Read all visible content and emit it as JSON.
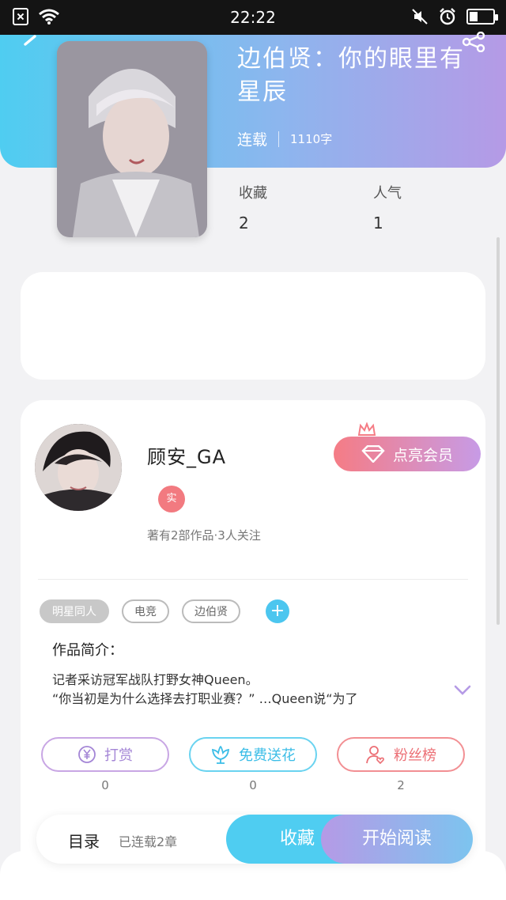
{
  "status_bar": {
    "time": "22:22",
    "icons": [
      "no-sim-icon",
      "wifi-icon",
      "mute-icon",
      "alarm-icon",
      "battery-icon"
    ],
    "battery_level": 0.35
  },
  "book": {
    "title": "边伯贤：你的眼里有星辰",
    "status": "连载",
    "word_count": "1110字",
    "favorites_label": "收藏",
    "favorites_value": "2",
    "popularity_label": "人气",
    "popularity_value": "1"
  },
  "author": {
    "name": "顾安_GA",
    "badge": "实",
    "stats": "著有2部作品·3人关注",
    "vip_button": "点亮会员"
  },
  "tags": [
    {
      "label": "明星同人",
      "filled": true
    },
    {
      "label": "电竞",
      "filled": false
    },
    {
      "label": "边伯贤",
      "filled": false
    }
  ],
  "tag_add": "+",
  "intro": {
    "heading": "作品简介：",
    "line1": "记者采访冠军战队打野女神Queen。",
    "line2": "“你当初是为什么选择去打职业赛？” …Queen说“为了"
  },
  "actions": [
    {
      "label": "打赏",
      "count": "0",
      "icon": "yuan-icon"
    },
    {
      "label": "免费送花",
      "count": "0",
      "icon": "flower-icon"
    },
    {
      "label": "粉丝榜",
      "count": "2",
      "icon": "fan-user-icon"
    }
  ],
  "bottom": {
    "toc": "目录",
    "serial": "已连载2章",
    "favorite": "收藏",
    "read": "开始阅读"
  },
  "colors": {
    "hero_start": "#4fcdf1",
    "hero_end": "#b59ae6",
    "accent_blue": "#4fcdf1",
    "accent_pink": "#f57c85",
    "accent_purple": "#b59ae6"
  }
}
